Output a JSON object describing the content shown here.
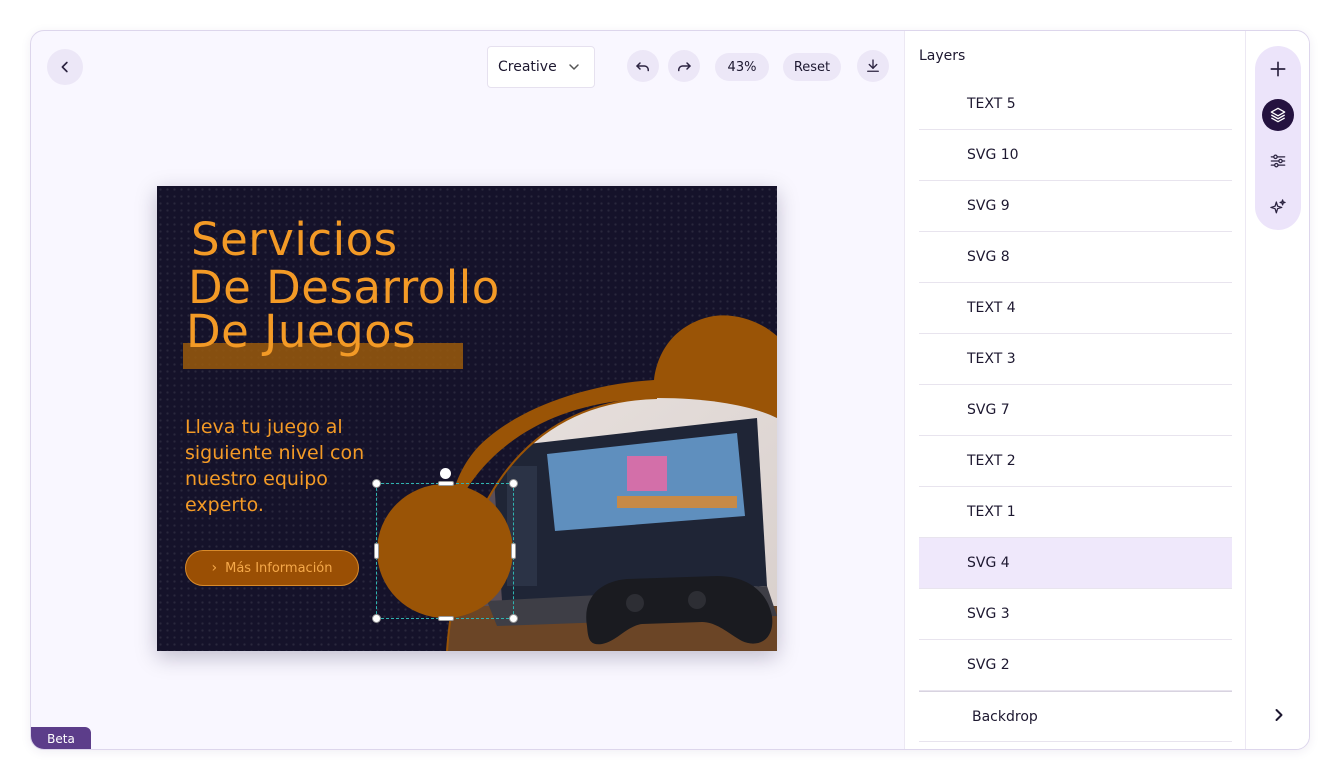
{
  "toolbar": {
    "mode_select_value": "Creative",
    "zoom_label": "43%",
    "reset_label": "Reset"
  },
  "canvas": {
    "headline": [
      "Servicios",
      "De Desarrollo",
      "De Juegos"
    ],
    "subtext": "Lleva tu juego al siguiente nivel con nuestro equipo experto.",
    "cta_label": "Más Información",
    "accent_color": "#f39a26",
    "shape_color": "#9a5406",
    "background_color": "#15122a"
  },
  "layers": {
    "title": "Layers",
    "items": [
      {
        "label": "TEXT 5"
      },
      {
        "label": "SVG 10"
      },
      {
        "label": "SVG 9"
      },
      {
        "label": "SVG 8"
      },
      {
        "label": "TEXT 4"
      },
      {
        "label": "TEXT 3"
      },
      {
        "label": "SVG 7"
      },
      {
        "label": "TEXT 2"
      },
      {
        "label": "TEXT 1"
      },
      {
        "label": "SVG 4",
        "selected": true
      },
      {
        "label": "SVG 3"
      },
      {
        "label": "SVG 2"
      }
    ],
    "backdrop_label": "Backdrop",
    "selected_color": "#efe8fb"
  },
  "rail": {
    "tools": [
      "plus-icon",
      "layers-icon",
      "sliders-icon",
      "sparkles-icon"
    ],
    "active_tool": "layers-icon"
  },
  "beta_label": "Beta"
}
